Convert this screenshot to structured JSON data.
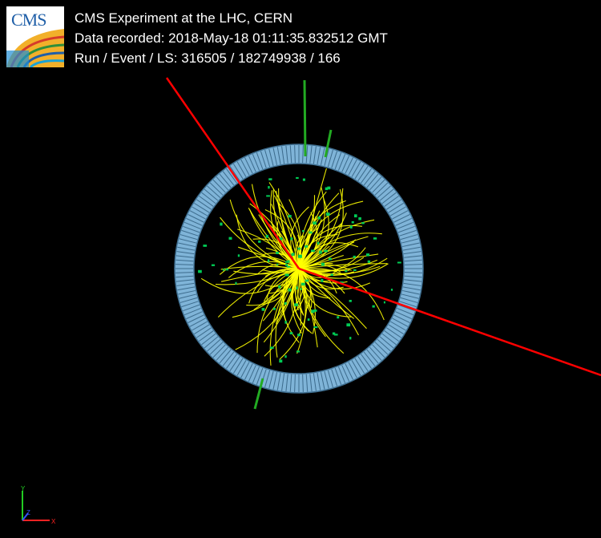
{
  "header": {
    "line1": "CMS Experiment at the LHC, CERN",
    "line2": "Data recorded: 2018-May-18 01:11:35.832512 GMT",
    "line3": "Run / Event / LS: 316505 / 182749938 / 166"
  },
  "logo": {
    "text": "CMS"
  },
  "axes": {
    "x_label": "X",
    "y_label": "Y",
    "z_label": "Z"
  },
  "colors": {
    "background": "#000000",
    "tracks": "#ffff00",
    "muons": "#ff0000",
    "jets": "#22aa22",
    "detector_ring": "#7fb4d8",
    "hits": "#00cc55"
  }
}
